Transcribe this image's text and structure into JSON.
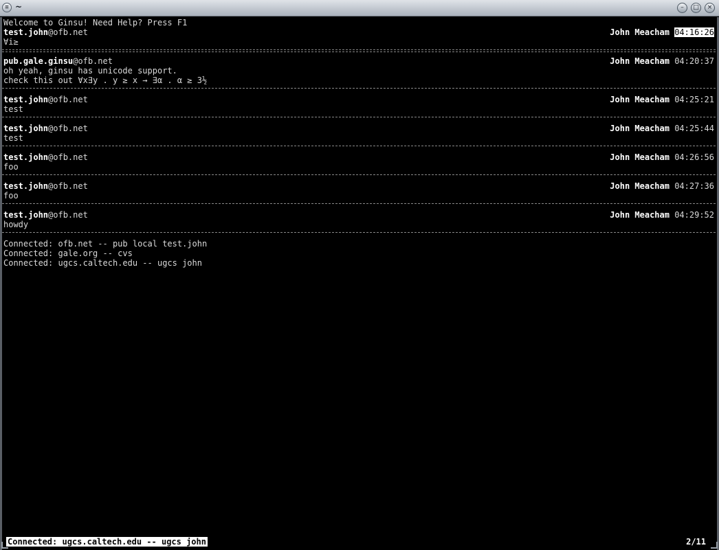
{
  "window": {
    "title": "~"
  },
  "welcome": "Welcome to Ginsu! Need Help? Press F1",
  "messages": [
    {
      "category": "test.john",
      "domain": "@ofb.net",
      "author": "John Meacham",
      "time": "04:16:26",
      "body": [
        "∀i≥"
      ]
    },
    {
      "category": "pub.gale.ginsu",
      "domain": "@ofb.net",
      "author": "John Meacham",
      "time": "04:20:37",
      "body": [
        "oh yeah, ginsu has unicode support.",
        "check this out ∀x∃y . y ≥ x → ∃α . α ≥ 3½"
      ]
    },
    {
      "category": "test.john",
      "domain": "@ofb.net",
      "author": "John Meacham",
      "time": "04:25:21",
      "body": [
        "test"
      ]
    },
    {
      "category": "test.john",
      "domain": "@ofb.net",
      "author": "John Meacham",
      "time": "04:25:44",
      "body": [
        "test"
      ]
    },
    {
      "category": "test.john",
      "domain": "@ofb.net",
      "author": "John Meacham",
      "time": "04:26:56",
      "body": [
        "foo"
      ]
    },
    {
      "category": "test.john",
      "domain": "@ofb.net",
      "author": "John Meacham",
      "time": "04:27:36",
      "body": [
        "foo"
      ]
    },
    {
      "category": "test.john",
      "domain": "@ofb.net",
      "author": "John Meacham",
      "time": "04:29:52",
      "body": [
        "howdy"
      ]
    }
  ],
  "connections": [
    "Connected: ofb.net -- pub local test.john",
    "Connected: gale.org -- cvs",
    "Connected: ugcs.caltech.edu -- ugcs john"
  ],
  "status": {
    "text": "Connected: ugcs.caltech.edu -- ugcs john",
    "page": "2/11"
  },
  "icons": {
    "menu": "window-menu-icon",
    "minimize": "minimize-icon",
    "maximize": "maximize-icon",
    "close": "close-icon"
  }
}
